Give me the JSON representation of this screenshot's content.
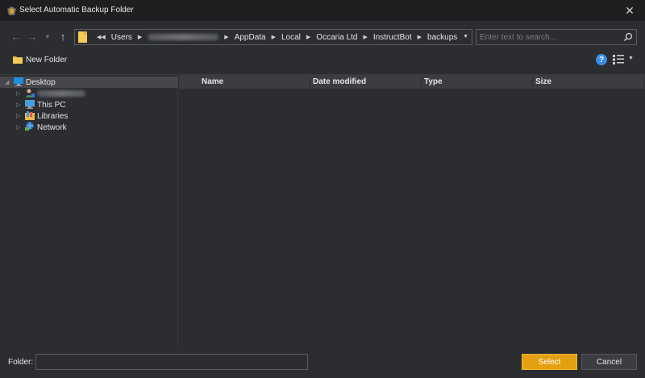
{
  "window": {
    "title": "Select Automatic Backup Folder",
    "close_glyph": "✕"
  },
  "nav": {
    "back_glyph": "←",
    "forward_glyph": "→",
    "history_glyph": "▼",
    "up_glyph": "↑"
  },
  "address": {
    "overflow_glyph": "◀◀",
    "separator_glyph": "▶",
    "crumbs": [
      "Users",
      "",
      "AppData",
      "Local",
      "Occaria Ltd",
      "InstructBot",
      "backups"
    ],
    "dropdown_glyph": "▼"
  },
  "search": {
    "placeholder": "Enter text to search..."
  },
  "toolbar": {
    "new_folder_label": "New Folder",
    "help_glyph": "?",
    "view_dropdown_glyph": "▼"
  },
  "tree": {
    "expanded_glyph": "◢",
    "collapsed_glyph": "▷",
    "items": [
      {
        "label": "Desktop",
        "icon": "desktop-icon",
        "selected": true
      },
      {
        "label": "",
        "icon": "user-icon",
        "selected": false
      },
      {
        "label": "This PC",
        "icon": "computer-icon",
        "selected": false
      },
      {
        "label": "Libraries",
        "icon": "libraries-icon",
        "selected": false
      },
      {
        "label": "Network",
        "icon": "network-icon",
        "selected": false
      }
    ]
  },
  "filelist": {
    "columns": [
      "Name",
      "Date modified",
      "Type",
      "Size"
    ],
    "rows": []
  },
  "bottom": {
    "folder_label": "Folder:",
    "folder_value": "",
    "select_label": "Select",
    "cancel_label": "Cancel"
  },
  "colors": {
    "accent": "#e3a112",
    "background": "#2b2d31",
    "titlebar": "#1f1f22",
    "header": "#3b3d42"
  }
}
